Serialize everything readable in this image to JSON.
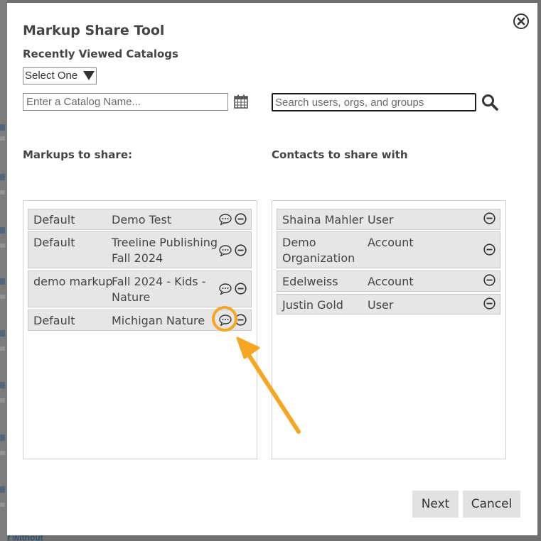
{
  "modal": {
    "title": "Markup Share Tool",
    "recent_label": "Recently Viewed Catalogs",
    "select_value": "Select One",
    "catalog_placeholder": "Enter a Catalog Name...",
    "search_placeholder": "Search users, orgs, and groups",
    "markups_label": "Markups to share:",
    "contacts_label": "Contacts to share with",
    "next_label": "Next",
    "cancel_label": "Cancel"
  },
  "markups": [
    {
      "name": "Default",
      "catalog": "Demo Test"
    },
    {
      "name": "Default",
      "catalog": "Treeline Publishing Fall 2024"
    },
    {
      "name": "demo markup",
      "catalog": "Fall 2024 - Kids - Nature"
    },
    {
      "name": "Default",
      "catalog": "Michigan Nature"
    }
  ],
  "contacts": [
    {
      "name": "Shaina Mahler",
      "type": "User"
    },
    {
      "name": "Demo Organization",
      "type": "Account"
    },
    {
      "name": "Edelweiss",
      "type": "Account"
    },
    {
      "name": "Justin Gold",
      "type": "User"
    }
  ],
  "background": {
    "partial_text": "r without"
  },
  "colors": {
    "highlight": "#f5a623",
    "row_bg": "#e6e6e6",
    "button_bg": "#e2e2e2",
    "backdrop": "#6f6f6f"
  },
  "icons": {
    "close": "close-circle-icon",
    "calendar": "calendar-icon",
    "search": "magnifier-icon",
    "comment": "speech-bubble-icon",
    "remove": "minus-circle-icon"
  }
}
